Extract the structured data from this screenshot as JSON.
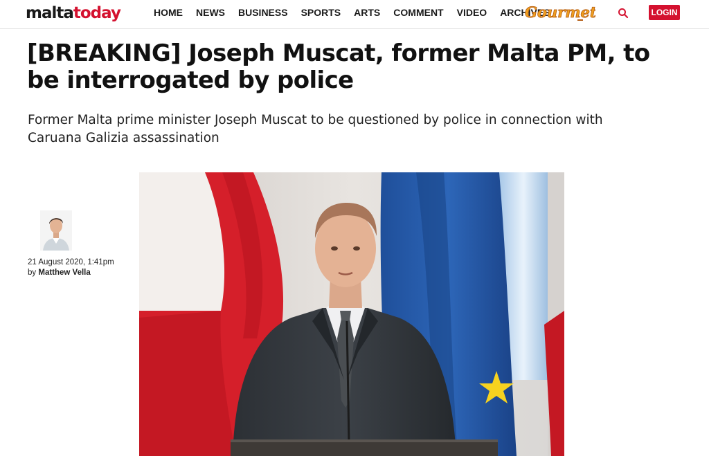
{
  "site": {
    "logo_part1": "malta",
    "logo_part2": "today",
    "logo_colors": {
      "dark": "#1a1a1a",
      "accent": "#d4112f"
    }
  },
  "nav": {
    "items": [
      "HOME",
      "NEWS",
      "BUSINESS",
      "SPORTS",
      "ARTS",
      "COMMENT",
      "VIDEO",
      "ARCHIVES"
    ],
    "gourmet_label": "Gourmet",
    "search_icon": "search-icon",
    "login_label": "LOGIN"
  },
  "article": {
    "headline": "[BREAKING] Joseph Muscat, former Malta PM, to be interrogated by police",
    "standfirst": "Former Malta prime minister Joseph Muscat to be questioned by police in connection with Caruana Galizia assassination",
    "date": "21 August 2020, 1:41pm",
    "by_prefix": "by",
    "author": "Matthew Vella"
  }
}
